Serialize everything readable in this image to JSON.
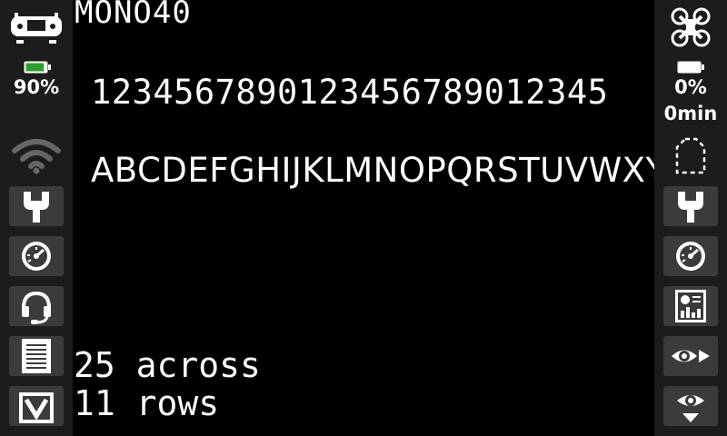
{
  "left_sidebar": {
    "battery_percent": "90%",
    "battery_level": 0.9,
    "icons": [
      "radio-icon",
      "battery-icon",
      "wifi-icon",
      "wrench-icon",
      "gauge-icon",
      "headset-icon",
      "document-icon",
      "folder-icon"
    ]
  },
  "right_sidebar": {
    "battery_percent": "0%",
    "time_remaining": "0min",
    "icons": [
      "drone-icon",
      "battery-icon",
      "dashed-frame-icon",
      "wrench-icon",
      "gauge-icon",
      "telemetry-screen-icon",
      "eye-arrow-icon",
      "eye-down-icon"
    ]
  },
  "main": {
    "font_name": "MONO40",
    "digits_line": "1234567890123456789012345",
    "letters_line": "ABCDEFGHIJKLMNOPQRSTUVWXY",
    "across_text": "25 across",
    "rows_text": "11 rows"
  },
  "colors": {
    "background": "#000000",
    "sidebar": "#1c1c1c",
    "button": "#3b3b3b",
    "battery_green": "#2ea02e"
  }
}
